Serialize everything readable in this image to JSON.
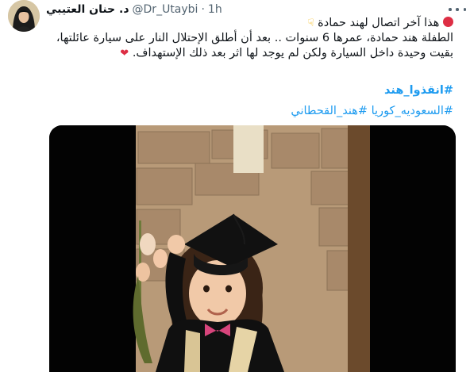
{
  "author": {
    "display_name": "د. حنان العتيبي",
    "handle": "@Dr_Utaybi",
    "separator": "·",
    "time": "1h"
  },
  "tweet": {
    "line1": "هذا آخر اتصال لهند حمادة",
    "line2": "الطفلة هند حمادة، عمرها 6 سنوات .. بعد أن أطلق الإحتلال النار على سيارة عائلتها،",
    "line3": "بقيت وحيدة داخل السيارة ولكن لم يوجد لها اثر بعد ذلك الإستهداف.",
    "hashtags_line1": "#انقذوا_هند",
    "hashtags_line2": "#السعوديه_كوريا #هند_القحطاني"
  },
  "icons": {
    "line1_start": "red-circle-icon",
    "line1_end": "pointing-down-icon",
    "line3_end": "broken-heart-icon",
    "more": "more-options-icon"
  },
  "colors": {
    "link": "#1d9bf0",
    "secondary_text": "#536471",
    "primary_text": "#0f1419"
  }
}
